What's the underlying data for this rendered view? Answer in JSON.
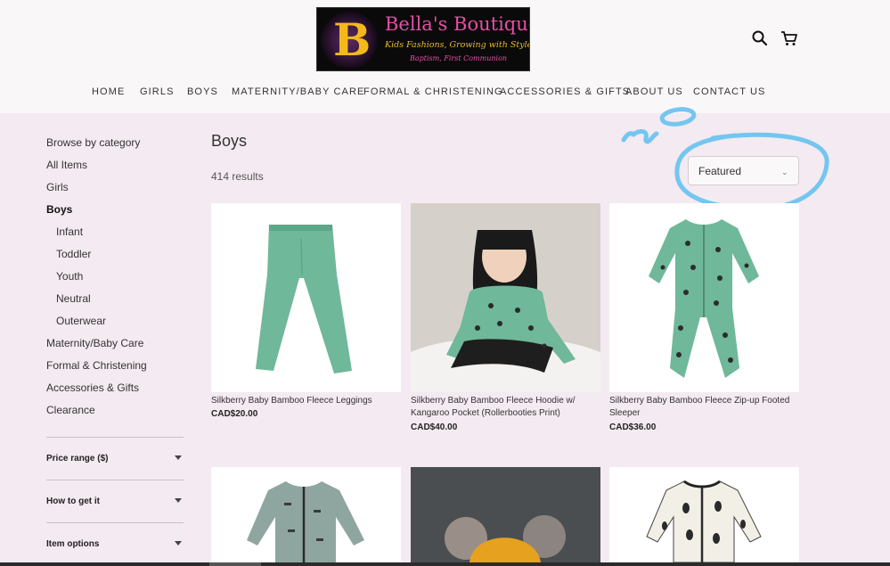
{
  "logo": {
    "letter": "B",
    "title": "Bella's Boutique",
    "tagline": "Kids Fashions, Growing with Style",
    "sub": "Baptism, First Communion"
  },
  "header_icons": [
    "search-icon",
    "cart-icon"
  ],
  "nav": [
    "HOME",
    "GIRLS",
    "BOYS",
    "MATERNITY/BABY CARE",
    "FORMAL & CHRISTENING",
    "ACCESSORIES & GIFTS",
    "ABOUT US",
    "CONTACT US"
  ],
  "sidebar": {
    "heading": "Browse by category",
    "items": [
      {
        "label": "All Items"
      },
      {
        "label": "Girls"
      },
      {
        "label": "Boys"
      },
      {
        "label": "Infant"
      },
      {
        "label": "Toddler"
      },
      {
        "label": "Youth"
      },
      {
        "label": "Neutral"
      },
      {
        "label": "Outerwear"
      },
      {
        "label": "Maternity/Baby Care"
      },
      {
        "label": "Formal & Christening"
      },
      {
        "label": "Accessories & Gifts"
      },
      {
        "label": "Clearance"
      }
    ],
    "filters": [
      "Price range ($)",
      "How to get it",
      "Item options"
    ]
  },
  "main": {
    "title": "Boys",
    "results": "414 results",
    "sort_value": "Featured",
    "annotation": "NO",
    "annotation_color": "#74c6f0"
  },
  "products": [
    {
      "name": "Silkberry Baby Bamboo Fleece Leggings",
      "price": "CAD$20.00"
    },
    {
      "name": "Silkberry Baby Bamboo Fleece Hoodie w/ Kangaroo Pocket (Rollerbooties Print)",
      "price": "CAD$40.00"
    },
    {
      "name": "Silkberry Baby Bamboo Fleece Zip-up Footed Sleeper",
      "price": "CAD$36.00"
    },
    {
      "name": "",
      "price": ""
    },
    {
      "name": "",
      "price": ""
    },
    {
      "name": "",
      "price": ""
    }
  ],
  "colors": {
    "page_bg": "#f4eaf1",
    "header_bg": "#faf7f9",
    "product_green": "#6fb89a",
    "logo_pink": "#e64fa6",
    "logo_gold": "#f3b91a"
  }
}
